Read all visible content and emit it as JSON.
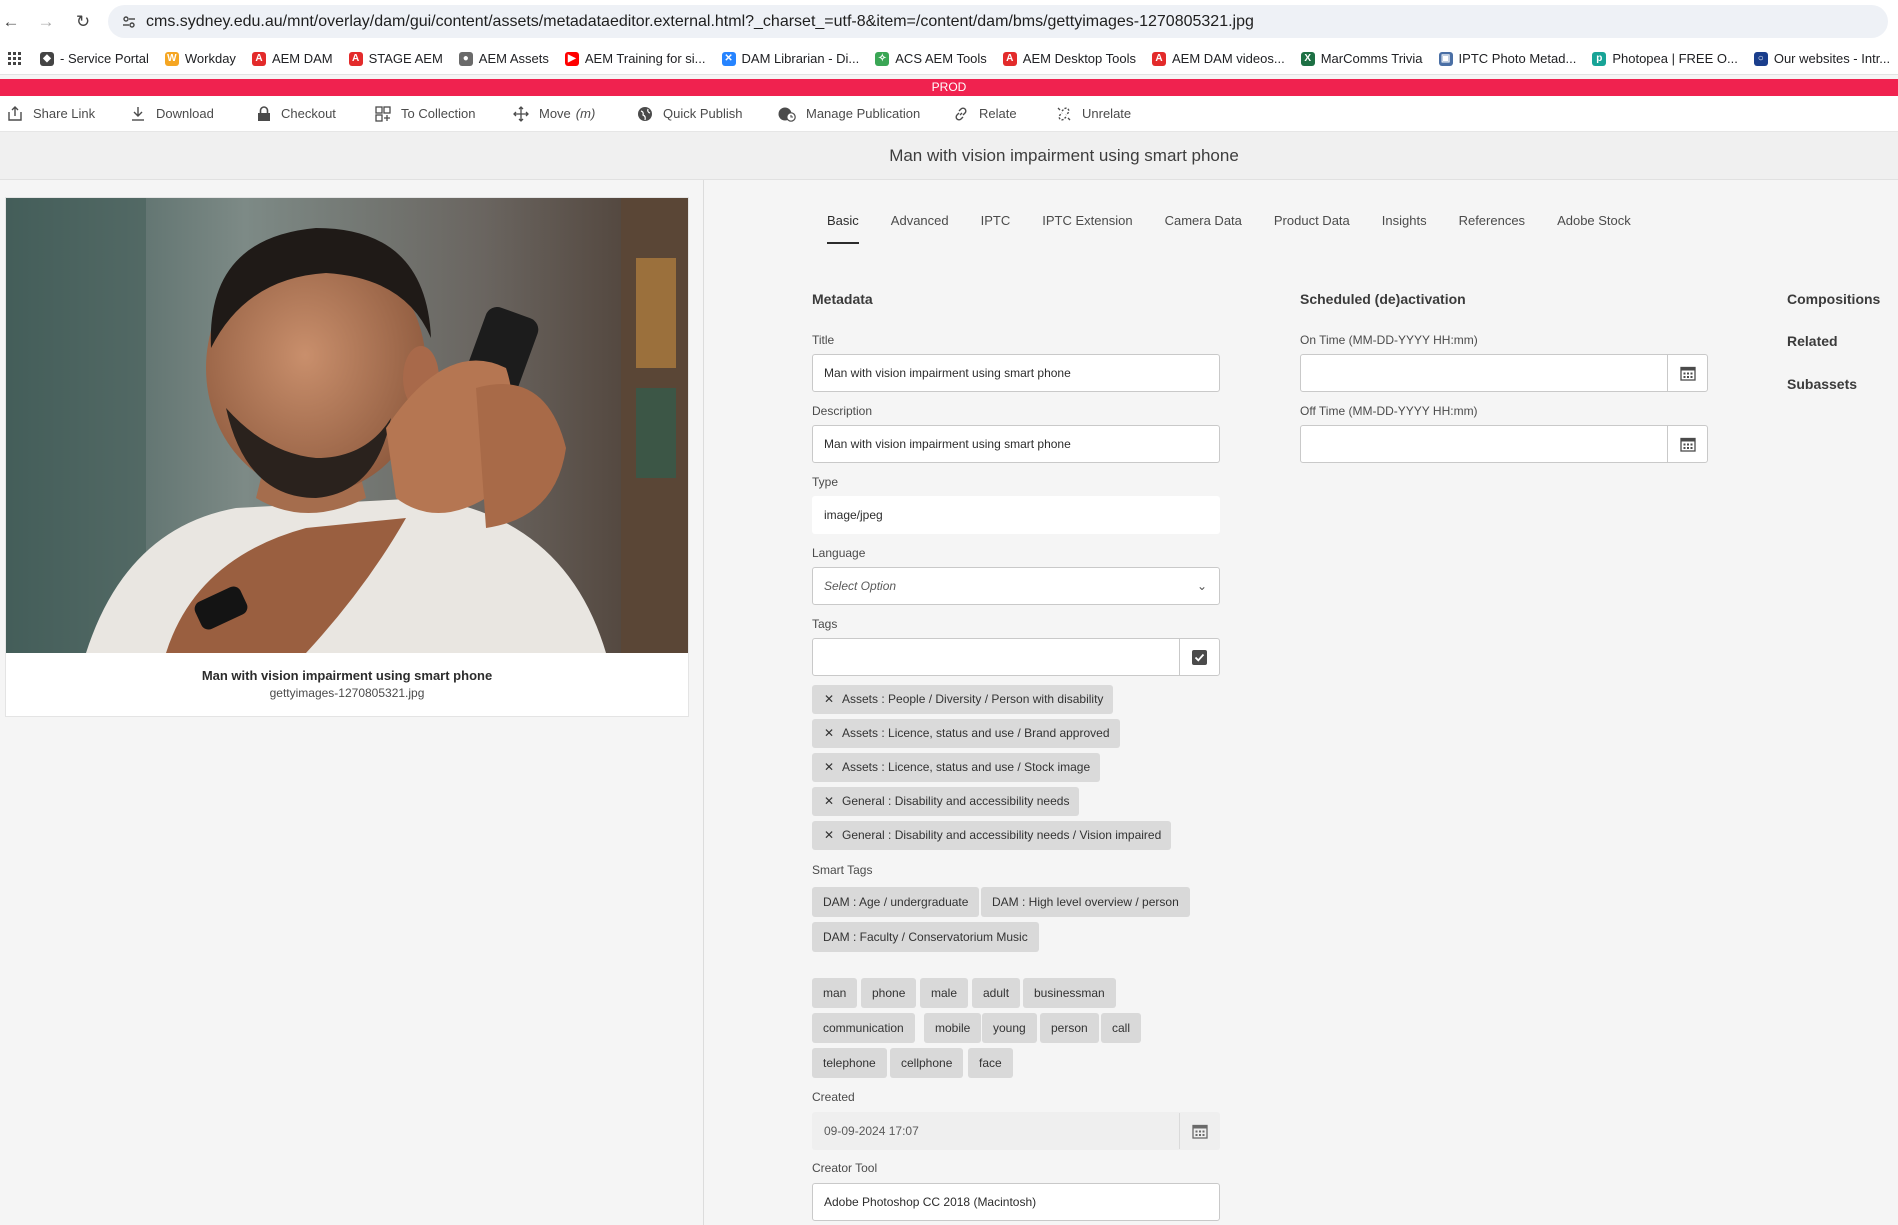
{
  "browser": {
    "url": "cms.sydney.edu.au/mnt/overlay/dam/gui/content/assets/metadataeditor.external.html?_charset_=utf-8&item=/content/dam/bms/gettyimages-1270805321.jpg"
  },
  "bookmarks": [
    {
      "label": "- Service Portal",
      "icon": "shield-icon",
      "color": "#444444"
    },
    {
      "label": "Workday",
      "icon": "workday-icon",
      "color": "#f5a623"
    },
    {
      "label": "AEM DAM",
      "icon": "adobe-icon",
      "color": "#e32b2b"
    },
    {
      "label": "STAGE AEM",
      "icon": "adobe-icon",
      "color": "#e32b2b"
    },
    {
      "label": "AEM Assets",
      "icon": "assets-icon",
      "color": "#6a6a6a"
    },
    {
      "label": "AEM Training for si...",
      "icon": "youtube-icon",
      "color": "#ff0000"
    },
    {
      "label": "DAM Librarian - Di...",
      "icon": "confluence-icon",
      "color": "#2684ff"
    },
    {
      "label": "ACS AEM Tools",
      "icon": "tools-icon",
      "color": "#3aa655"
    },
    {
      "label": "AEM Desktop Tools",
      "icon": "adobe-icon",
      "color": "#e32b2b"
    },
    {
      "label": "AEM DAM videos...",
      "icon": "adobe-icon",
      "color": "#e32b2b"
    },
    {
      "label": "MarComms Trivia",
      "icon": "excel-icon",
      "color": "#1d7044"
    },
    {
      "label": "IPTC Photo Metad...",
      "icon": "iptc-icon",
      "color": "#4a6fa5"
    },
    {
      "label": "Photopea | FREE O...",
      "icon": "photopea-icon",
      "color": "#18a497"
    },
    {
      "label": "Our websites - Intr...",
      "icon": "circle-icon",
      "color": "#1a3e8c"
    }
  ],
  "env_label": "PROD",
  "actions": [
    {
      "label": "Share Link",
      "icon": "share-icon"
    },
    {
      "label": "Download",
      "icon": "download-icon"
    },
    {
      "label": "Checkout",
      "icon": "lock-icon"
    },
    {
      "label": "To Collection",
      "icon": "collection-icon"
    },
    {
      "label": "Move",
      "shortcut": "(m)",
      "icon": "move-icon"
    },
    {
      "label": "Quick Publish",
      "icon": "globe-icon"
    },
    {
      "label": "Manage Publication",
      "icon": "globe-clock-icon"
    },
    {
      "label": "Relate",
      "icon": "link-icon"
    },
    {
      "label": "Unrelate",
      "icon": "unlink-icon"
    }
  ],
  "page_title": "Man with vision impairment using smart phone",
  "preview": {
    "title": "Man with vision impairment using smart phone",
    "filename": "gettyimages-1270805321.jpg"
  },
  "tabs": [
    "Basic",
    "Advanced",
    "IPTC",
    "IPTC Extension",
    "Camera Data",
    "Product Data",
    "Insights",
    "References",
    "Adobe Stock"
  ],
  "active_tab": "Basic",
  "metadata": {
    "heading": "Metadata",
    "title_label": "Title",
    "title_value": "Man with vision impairment using smart phone",
    "description_label": "Description",
    "description_value": "Man with vision impairment using smart phone",
    "type_label": "Type",
    "type_value": "image/jpeg",
    "language_label": "Language",
    "language_placeholder": "Select Option",
    "tags_label": "Tags",
    "tags": [
      "Assets : People / Diversity / Person with disability",
      "Assets : Licence, status and use / Brand approved",
      "Assets : Licence, status and use / Stock image",
      "General : Disability and accessibility needs",
      "General : Disability and accessibility needs / Vision impaired"
    ],
    "smart_tags_label": "Smart Tags",
    "smart_tags": [
      "DAM : Age / undergraduate",
      "DAM : High level overview / person",
      "DAM : Faculty / Conservatorium Music"
    ],
    "keywords": [
      "man",
      "phone",
      "male",
      "adult",
      "businessman",
      "communication",
      "mobile",
      "young",
      "person",
      "call",
      "telephone",
      "cellphone",
      "face"
    ],
    "created_label": "Created",
    "created_value": "09-09-2024 17:07",
    "creator_tool_label": "Creator Tool",
    "creator_tool_value": "Adobe Photoshop CC 2018 (Macintosh)"
  },
  "scheduled": {
    "heading": "Scheduled (de)activation",
    "on_label": "On Time (MM-DD-YYYY HH:mm)",
    "on_value": "",
    "off_label": "Off Time (MM-DD-YYYY HH:mm)",
    "off_value": ""
  },
  "right_links": [
    "Compositions",
    "Related",
    "Subassets"
  ]
}
